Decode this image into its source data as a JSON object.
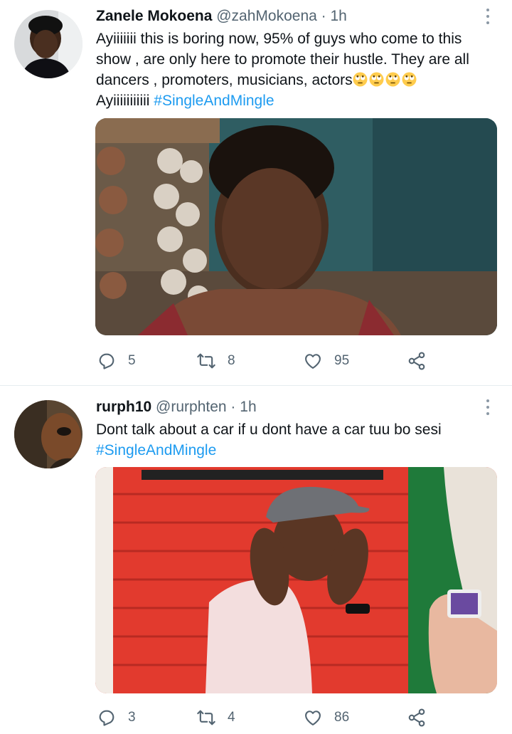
{
  "tweets": [
    {
      "display_name": "Zanele Mokoena",
      "handle": "@zahMokoena",
      "separator": "·",
      "time": "1h",
      "text_line_1": "Ayiiiiiii this is boring now, 95% of guys who come to this",
      "text_line_2": "show , are only here to promote their hustle. They are all",
      "text_line_3": "dancers , promoters, musicians, actors",
      "text_line_4_prefix": "Ayiiiiiiiiiii ",
      "hashtag": "#SingleAndMingle",
      "emoji_icon": "eye-roll-emoji-icon",
      "reply_count": "5",
      "retweet_count": "8",
      "like_count": "95"
    },
    {
      "display_name": "rurph10",
      "handle": "@rurphten",
      "separator": "·",
      "time": "1h",
      "text_line_1": "Dont talk  about a car if u dont have a car tuu bo sesi",
      "hashtag": "#SingleAndMingle",
      "reply_count": "3",
      "retweet_count": "4",
      "like_count": "86"
    }
  ],
  "icons": {
    "reply": "reply-icon",
    "retweet": "retweet-icon",
    "like": "heart-icon",
    "share": "share-icon",
    "more": "more-options-icon"
  },
  "colors": {
    "link": "#1d9bf0",
    "secondary_text": "#536471",
    "primary_text": "#0f1419"
  }
}
